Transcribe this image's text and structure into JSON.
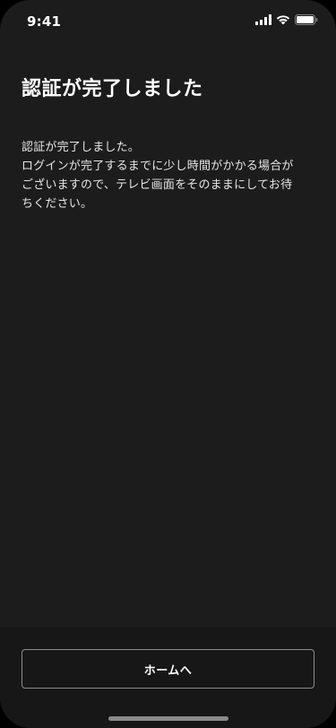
{
  "status_bar": {
    "time": "9:41",
    "icons": [
      "cellular-signal-icon",
      "wifi-icon",
      "battery-icon"
    ]
  },
  "page": {
    "title": "認証が完了しました",
    "message_lines": [
      "認証が完了しました。",
      "ログインが完了するまでに少し時間がかかる場合が",
      "ございますので、テレビ画面をそのままにしてお待",
      "ちください。"
    ]
  },
  "actions": {
    "home_label": "ホームへ"
  },
  "colors": {
    "background": "#1c1c1c",
    "text": "#ffffff",
    "button_border": "#8c8c8c"
  }
}
